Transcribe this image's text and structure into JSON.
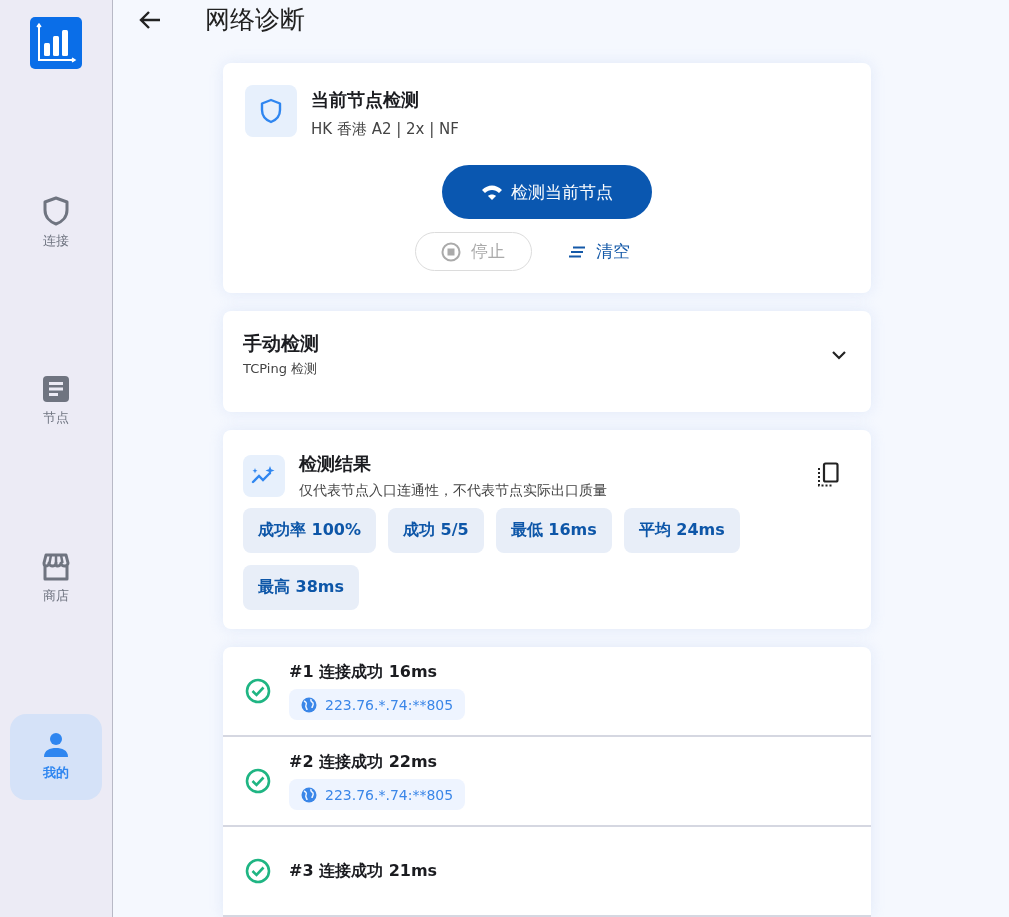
{
  "sidebar": {
    "items": [
      {
        "label": "连接",
        "kind": "shield",
        "selected": false
      },
      {
        "label": "节点",
        "kind": "list",
        "selected": false
      },
      {
        "label": "商店",
        "kind": "store",
        "selected": false
      },
      {
        "label": "我的",
        "kind": "person",
        "selected": true
      }
    ]
  },
  "header": {
    "title": "网络诊断"
  },
  "node_check": {
    "title": "当前节点检测",
    "node": "HK 香港 A2 | 2x | NF",
    "check_button": "检测当前节点",
    "stop_button": {
      "label": "停止",
      "disabled": true
    },
    "clear_button": "清空"
  },
  "manual_check": {
    "title": "手动检测",
    "subtitle": "TCPing 检测",
    "expanded": false
  },
  "results": {
    "title": "检测结果",
    "note": "仅代表节点入口连通性，不代表节点实际出口质量",
    "stats": [
      "成功率 100%",
      "成功 5/5",
      "最低 16ms",
      "平均 24ms",
      "最高 38ms"
    ]
  },
  "pings": [
    {
      "title": "#1 连接成功 16ms",
      "address": "223.76.*.74:**805",
      "success": true
    },
    {
      "title": "#2 连接成功 22ms",
      "address": "223.76.*.74:**805",
      "success": true
    },
    {
      "title": "#3 连接成功 21ms",
      "success": true
    }
  ]
}
